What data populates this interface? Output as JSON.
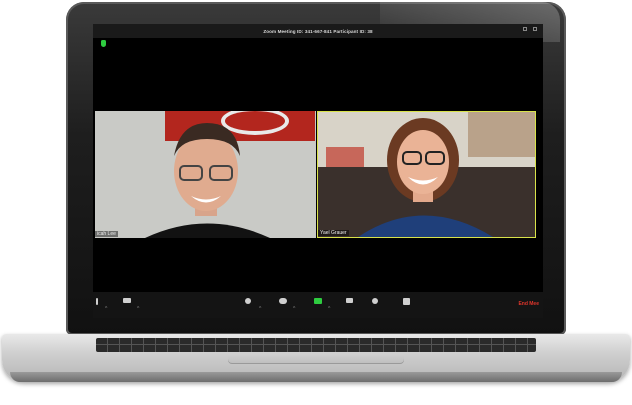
{
  "window": {
    "title": "Zoom Meeting ID: 341-667-841 Participant ID: 38"
  },
  "participants": [
    {
      "name": "icah Lee"
    },
    {
      "name": "Yael Grauer"
    }
  ],
  "toolbar": {
    "buttons": [
      "mute-icon",
      "video-icon",
      "manage-participants-icon",
      "participants-icon",
      "share-screen-icon",
      "chat-icon",
      "record-icon",
      "breakout-rooms-icon"
    ],
    "end_label": "End Mee"
  },
  "colors": {
    "active_speaker_border": "#d8e24a",
    "share_green": "#2ecc40",
    "end_red": "#e0352b"
  }
}
